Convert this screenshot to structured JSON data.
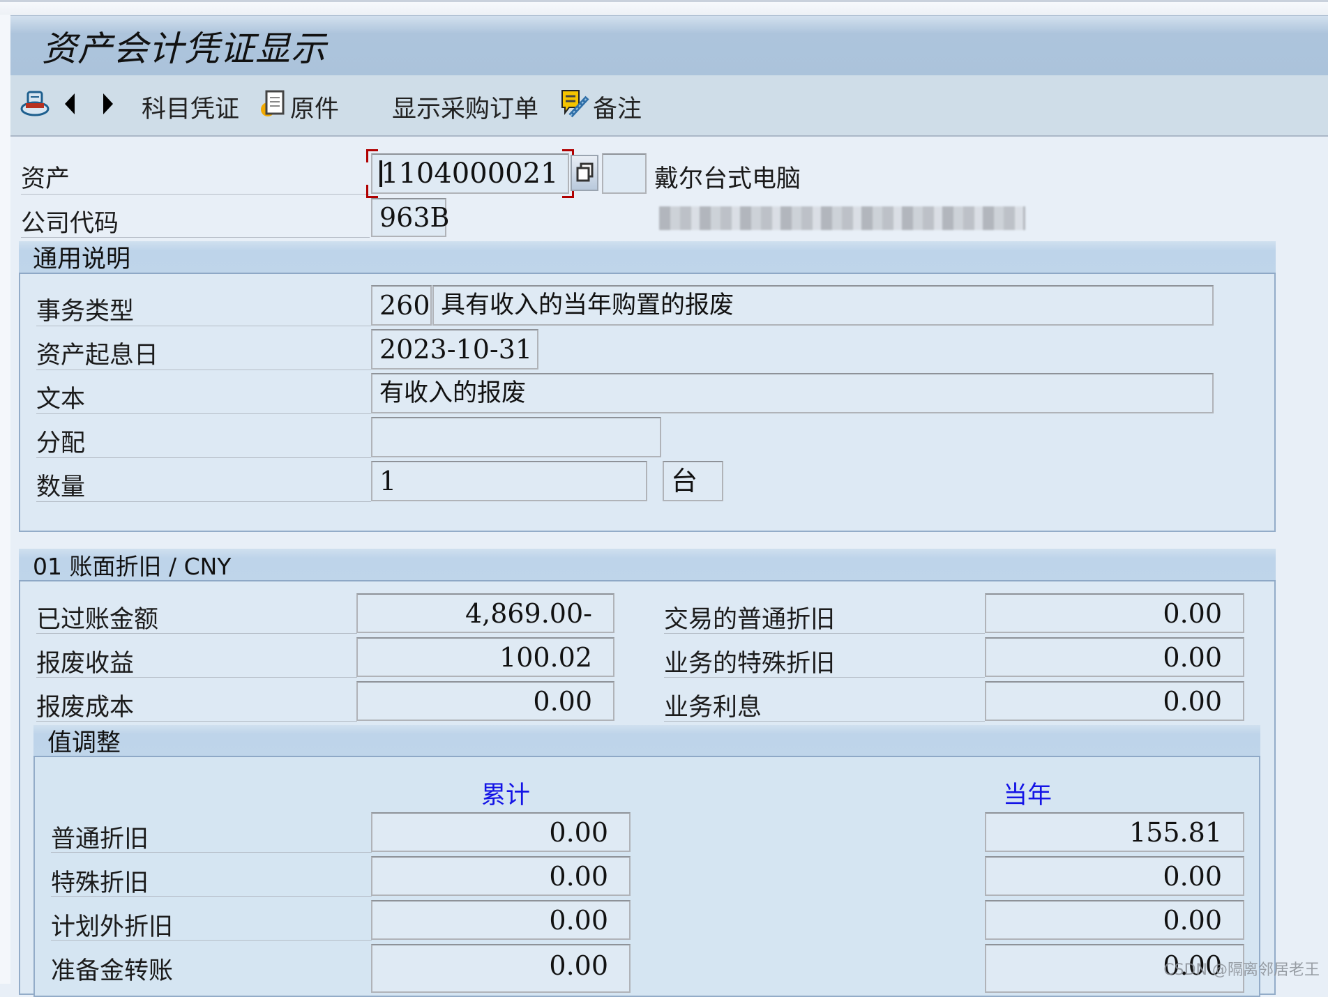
{
  "window": {
    "title": "资产会计凭证显示"
  },
  "toolbar": {
    "items": [
      {
        "icon": "hat-icon",
        "label": ""
      },
      {
        "icon": "previous-icon",
        "label": ""
      },
      {
        "icon": "next-icon",
        "label": ""
      },
      {
        "icon": "",
        "label": "科目凭证"
      },
      {
        "icon": "document-icon",
        "label": "原件"
      },
      {
        "icon": "",
        "label": "显示采购订单"
      },
      {
        "icon": "note-edit-icon",
        "label": "备注"
      }
    ]
  },
  "header": {
    "asset_label": "资产",
    "asset_number": "1104000021",
    "asset_subnumber": "",
    "asset_description": "戴尔台式电脑",
    "company_code_label": "公司代码",
    "company_code": "963B",
    "company_name": "(blurred)"
  },
  "general": {
    "title": "通用说明",
    "transaction_type_label": "事务类型",
    "transaction_type_code": "260",
    "transaction_type_text": "具有收入的当年购置的报废",
    "value_date_label": "资产起息日",
    "value_date": "2023-10-31",
    "text_label": "文本",
    "text": "有收入的报废",
    "assignment_label": "分配",
    "assignment": "",
    "quantity_label": "数量",
    "quantity": "1",
    "unit": "台"
  },
  "depreciation": {
    "title": "01 账面折旧 / CNY",
    "left": [
      {
        "label": "已过账金额",
        "value": "4,869.00-"
      },
      {
        "label": "报废收益",
        "value": "100.02"
      },
      {
        "label": "报废成本",
        "value": "0.00"
      }
    ],
    "right": [
      {
        "label": "交易的普通折旧",
        "value": "0.00"
      },
      {
        "label": "业务的特殊折旧",
        "value": "0.00"
      },
      {
        "label": "业务利息",
        "value": "0.00"
      }
    ]
  },
  "value_adjustment": {
    "title": "值调整",
    "col_cumulative": "累计",
    "col_current_year": "当年",
    "rows": [
      {
        "label": "普通折旧",
        "cumulative": "0.00",
        "current_year": "155.81"
      },
      {
        "label": "特殊折旧",
        "cumulative": "0.00",
        "current_year": "0.00"
      },
      {
        "label": "计划外折旧",
        "cumulative": "0.00",
        "current_year": "0.00"
      },
      {
        "label": "准备金转账",
        "cumulative": "0.00",
        "current_year": "0.00"
      }
    ]
  },
  "watermark": "CSDN @隔离邻居老王"
}
